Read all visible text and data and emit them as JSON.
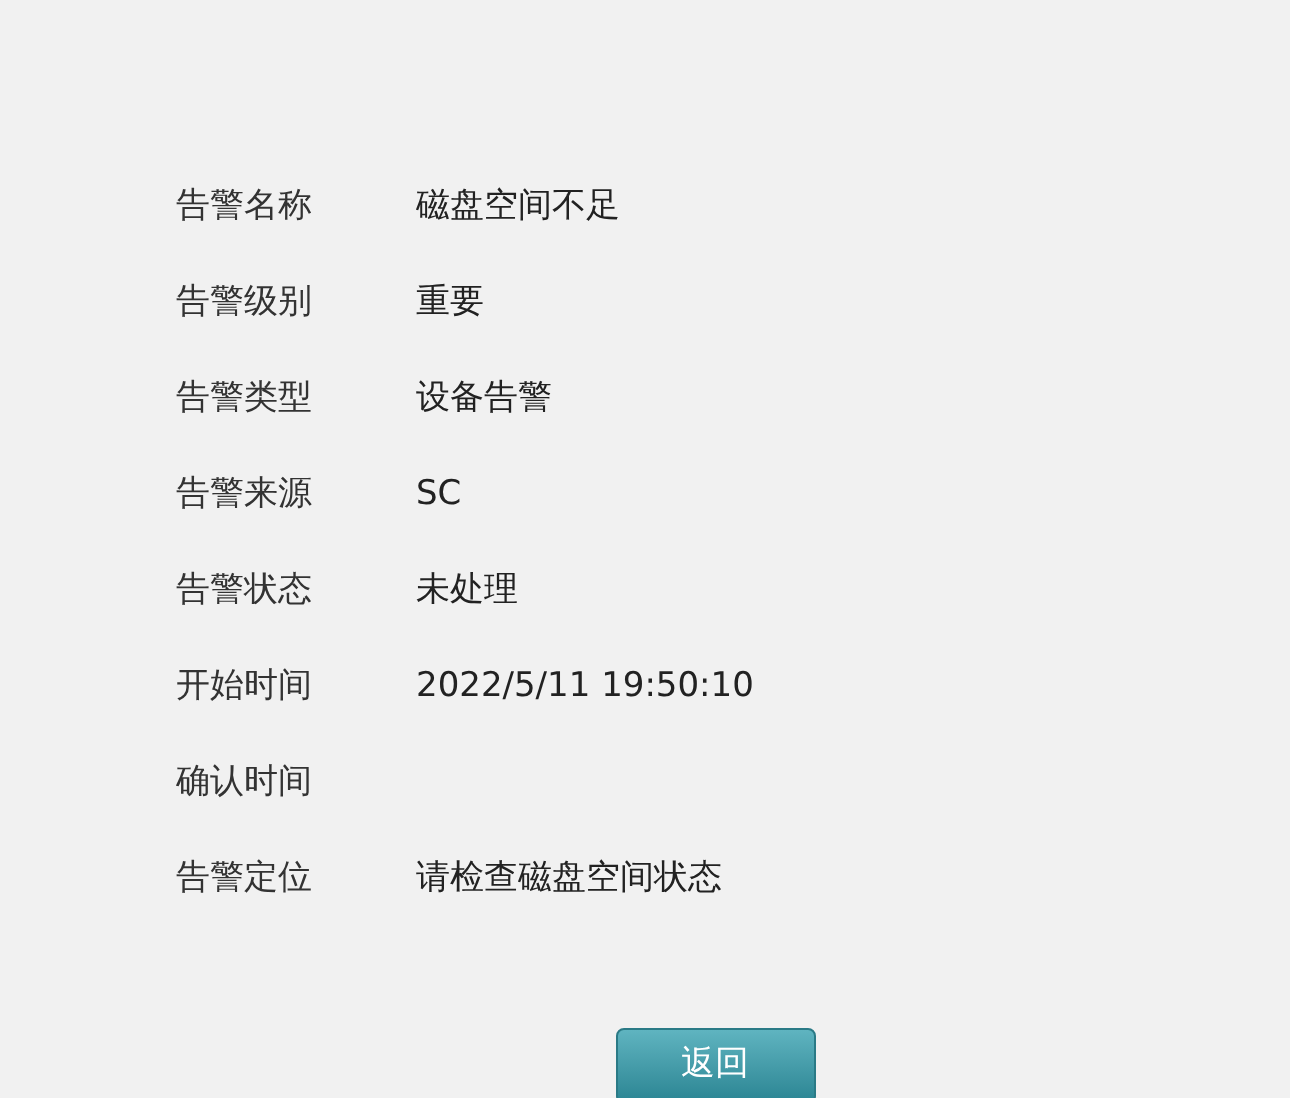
{
  "fields": [
    {
      "label": "告警名称",
      "value": "磁盘空间不足"
    },
    {
      "label": "告警级别",
      "value": "重要"
    },
    {
      "label": "告警类型",
      "value": "设备告警"
    },
    {
      "label": "告警来源",
      "value": "SC"
    },
    {
      "label": "告警状态",
      "value": "未处理"
    },
    {
      "label": "开始时间",
      "value": "2022/5/11 19:50:10"
    },
    {
      "label": "确认时间"
    },
    {
      "label": "告警定位",
      "value": "请检查磁盘空间状态"
    }
  ],
  "button": "返回"
}
